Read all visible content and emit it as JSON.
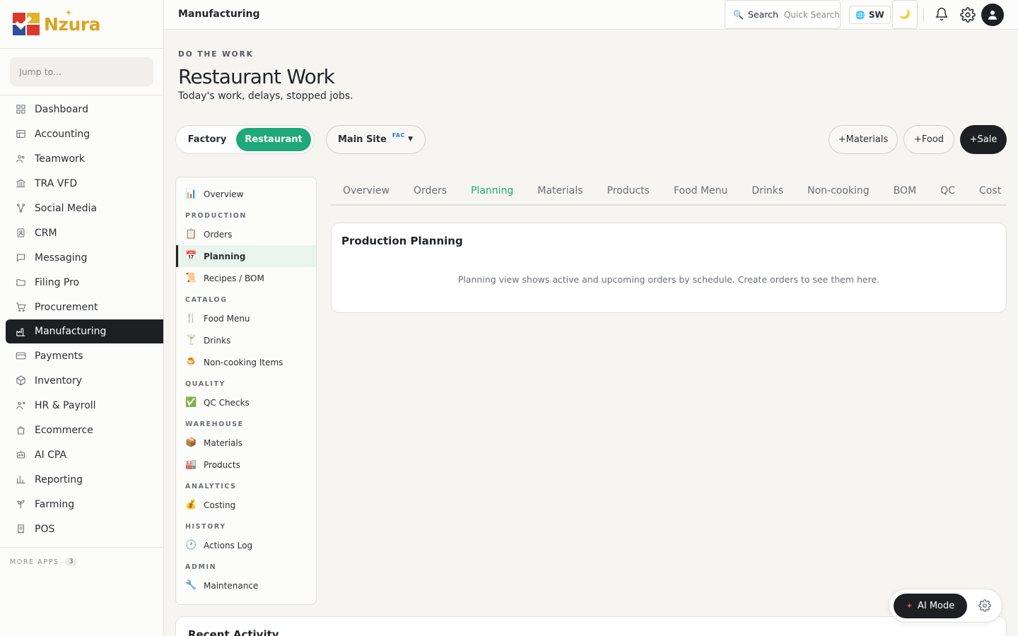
{
  "brand": {
    "name": "Nzura",
    "accent": "#1fa87a",
    "dark": "#1d1f22"
  },
  "sidebar": {
    "jump_placeholder": "Jump to...",
    "items": [
      {
        "label": "Dashboard",
        "icon": "dashboard-icon"
      },
      {
        "label": "Accounting",
        "icon": "accounting-icon"
      },
      {
        "label": "Teamwork",
        "icon": "teamwork-icon"
      },
      {
        "label": "TRA VFD",
        "icon": "bank-icon"
      },
      {
        "label": "Social Media",
        "icon": "social-icon"
      },
      {
        "label": "CRM",
        "icon": "contact-icon"
      },
      {
        "label": "Messaging",
        "icon": "message-icon"
      },
      {
        "label": "Filing Pro",
        "icon": "folder-icon"
      },
      {
        "label": "Procurement",
        "icon": "cart-icon"
      },
      {
        "label": "Manufacturing",
        "icon": "factory-icon",
        "active": true
      },
      {
        "label": "Payments",
        "icon": "card-icon"
      },
      {
        "label": "Inventory",
        "icon": "box-icon"
      },
      {
        "label": "HR & Payroll",
        "icon": "people-icon"
      },
      {
        "label": "Ecommerce",
        "icon": "bag-icon"
      },
      {
        "label": "AI CPA",
        "icon": "robot-icon"
      },
      {
        "label": "Reporting",
        "icon": "chart-icon"
      },
      {
        "label": "Farming",
        "icon": "sprout-icon"
      },
      {
        "label": "POS",
        "icon": "receipt-icon"
      }
    ],
    "more_apps_label": "MORE APPS",
    "more_apps_count": "3"
  },
  "topbar": {
    "title": "Manufacturing",
    "search_label": "Search",
    "search_hint": "Quick Search",
    "language": "SW"
  },
  "header": {
    "eyebrow": "DO THE WORK",
    "title": "Restaurant Work",
    "subtitle": "Today's work, delays, stopped jobs."
  },
  "mode": {
    "factory": "Factory",
    "restaurant": "Restaurant",
    "selected": "Restaurant"
  },
  "site": {
    "label": "Main Site",
    "tag": "FAC"
  },
  "actions": {
    "materials": "+Materials",
    "food": "+Food",
    "sale": "+Sale"
  },
  "subnav": {
    "top": {
      "label": "Overview",
      "icon": "📊"
    },
    "sections": [
      {
        "title": "PRODUCTION",
        "items": [
          {
            "label": "Orders",
            "icon": "📋"
          },
          {
            "label": "Planning",
            "icon": "📅",
            "active": true
          },
          {
            "label": "Recipes / BOM",
            "icon": "📜"
          }
        ]
      },
      {
        "title": "CATALOG",
        "items": [
          {
            "label": "Food Menu",
            "icon": "🍴"
          },
          {
            "label": "Drinks",
            "icon": "🍸"
          },
          {
            "label": "Non-cooking Items",
            "icon": "🍮"
          }
        ]
      },
      {
        "title": "QUALITY",
        "items": [
          {
            "label": "QC Checks",
            "icon": "✅"
          }
        ]
      },
      {
        "title": "WAREHOUSE",
        "items": [
          {
            "label": "Materials",
            "icon": "📦"
          },
          {
            "label": "Products",
            "icon": "🏭"
          }
        ]
      },
      {
        "title": "ANALYTICS",
        "items": [
          {
            "label": "Costing",
            "icon": "💰"
          }
        ]
      },
      {
        "title": "HISTORY",
        "items": [
          {
            "label": "Actions Log",
            "icon": "🕐"
          }
        ]
      },
      {
        "title": "ADMIN",
        "items": [
          {
            "label": "Maintenance",
            "icon": "🔧"
          }
        ]
      }
    ]
  },
  "tabs": [
    {
      "label": "Overview"
    },
    {
      "label": "Orders"
    },
    {
      "label": "Planning",
      "active": true
    },
    {
      "label": "Materials"
    },
    {
      "label": "Products"
    },
    {
      "label": "Food Menu"
    },
    {
      "label": "Drinks"
    },
    {
      "label": "Non-cooking"
    },
    {
      "label": "BOM"
    },
    {
      "label": "QC"
    },
    {
      "label": "Cost"
    }
  ],
  "planning": {
    "title": "Production Planning",
    "message": "Planning view shows active and upcoming orders by schedule. Create orders to see them here."
  },
  "recent": {
    "title": "Recent Activity"
  },
  "ai": {
    "label": "AI Mode"
  }
}
